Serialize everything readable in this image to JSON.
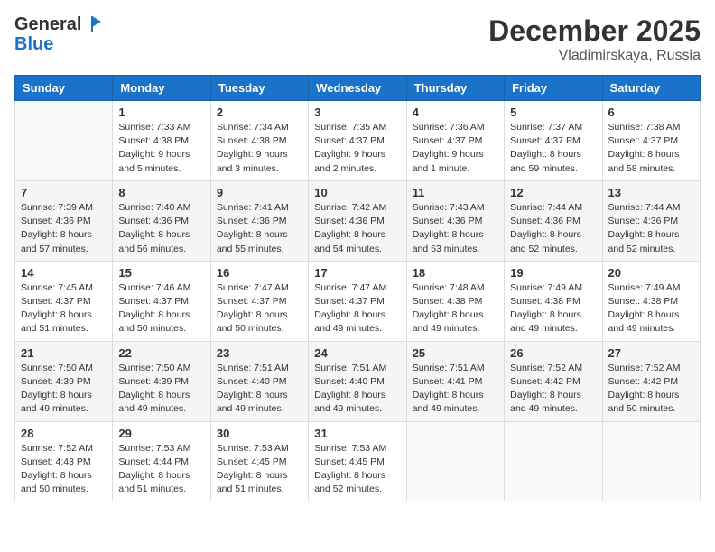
{
  "header": {
    "logo_line1": "General",
    "logo_line2": "Blue",
    "month": "December 2025",
    "location": "Vladimirskaya, Russia"
  },
  "weekdays": [
    "Sunday",
    "Monday",
    "Tuesday",
    "Wednesday",
    "Thursday",
    "Friday",
    "Saturday"
  ],
  "weeks": [
    [
      {
        "day": "",
        "sunrise": "",
        "sunset": "",
        "daylight": ""
      },
      {
        "day": "1",
        "sunrise": "Sunrise: 7:33 AM",
        "sunset": "Sunset: 4:38 PM",
        "daylight": "Daylight: 9 hours and 5 minutes."
      },
      {
        "day": "2",
        "sunrise": "Sunrise: 7:34 AM",
        "sunset": "Sunset: 4:38 PM",
        "daylight": "Daylight: 9 hours and 3 minutes."
      },
      {
        "day": "3",
        "sunrise": "Sunrise: 7:35 AM",
        "sunset": "Sunset: 4:37 PM",
        "daylight": "Daylight: 9 hours and 2 minutes."
      },
      {
        "day": "4",
        "sunrise": "Sunrise: 7:36 AM",
        "sunset": "Sunset: 4:37 PM",
        "daylight": "Daylight: 9 hours and 1 minute."
      },
      {
        "day": "5",
        "sunrise": "Sunrise: 7:37 AM",
        "sunset": "Sunset: 4:37 PM",
        "daylight": "Daylight: 8 hours and 59 minutes."
      },
      {
        "day": "6",
        "sunrise": "Sunrise: 7:38 AM",
        "sunset": "Sunset: 4:37 PM",
        "daylight": "Daylight: 8 hours and 58 minutes."
      }
    ],
    [
      {
        "day": "7",
        "sunrise": "Sunrise: 7:39 AM",
        "sunset": "Sunset: 4:36 PM",
        "daylight": "Daylight: 8 hours and 57 minutes."
      },
      {
        "day": "8",
        "sunrise": "Sunrise: 7:40 AM",
        "sunset": "Sunset: 4:36 PM",
        "daylight": "Daylight: 8 hours and 56 minutes."
      },
      {
        "day": "9",
        "sunrise": "Sunrise: 7:41 AM",
        "sunset": "Sunset: 4:36 PM",
        "daylight": "Daylight: 8 hours and 55 minutes."
      },
      {
        "day": "10",
        "sunrise": "Sunrise: 7:42 AM",
        "sunset": "Sunset: 4:36 PM",
        "daylight": "Daylight: 8 hours and 54 minutes."
      },
      {
        "day": "11",
        "sunrise": "Sunrise: 7:43 AM",
        "sunset": "Sunset: 4:36 PM",
        "daylight": "Daylight: 8 hours and 53 minutes."
      },
      {
        "day": "12",
        "sunrise": "Sunrise: 7:44 AM",
        "sunset": "Sunset: 4:36 PM",
        "daylight": "Daylight: 8 hours and 52 minutes."
      },
      {
        "day": "13",
        "sunrise": "Sunrise: 7:44 AM",
        "sunset": "Sunset: 4:36 PM",
        "daylight": "Daylight: 8 hours and 52 minutes."
      }
    ],
    [
      {
        "day": "14",
        "sunrise": "Sunrise: 7:45 AM",
        "sunset": "Sunset: 4:37 PM",
        "daylight": "Daylight: 8 hours and 51 minutes."
      },
      {
        "day": "15",
        "sunrise": "Sunrise: 7:46 AM",
        "sunset": "Sunset: 4:37 PM",
        "daylight": "Daylight: 8 hours and 50 minutes."
      },
      {
        "day": "16",
        "sunrise": "Sunrise: 7:47 AM",
        "sunset": "Sunset: 4:37 PM",
        "daylight": "Daylight: 8 hours and 50 minutes."
      },
      {
        "day": "17",
        "sunrise": "Sunrise: 7:47 AM",
        "sunset": "Sunset: 4:37 PM",
        "daylight": "Daylight: 8 hours and 49 minutes."
      },
      {
        "day": "18",
        "sunrise": "Sunrise: 7:48 AM",
        "sunset": "Sunset: 4:38 PM",
        "daylight": "Daylight: 8 hours and 49 minutes."
      },
      {
        "day": "19",
        "sunrise": "Sunrise: 7:49 AM",
        "sunset": "Sunset: 4:38 PM",
        "daylight": "Daylight: 8 hours and 49 minutes."
      },
      {
        "day": "20",
        "sunrise": "Sunrise: 7:49 AM",
        "sunset": "Sunset: 4:38 PM",
        "daylight": "Daylight: 8 hours and 49 minutes."
      }
    ],
    [
      {
        "day": "21",
        "sunrise": "Sunrise: 7:50 AM",
        "sunset": "Sunset: 4:39 PM",
        "daylight": "Daylight: 8 hours and 49 minutes."
      },
      {
        "day": "22",
        "sunrise": "Sunrise: 7:50 AM",
        "sunset": "Sunset: 4:39 PM",
        "daylight": "Daylight: 8 hours and 49 minutes."
      },
      {
        "day": "23",
        "sunrise": "Sunrise: 7:51 AM",
        "sunset": "Sunset: 4:40 PM",
        "daylight": "Daylight: 8 hours and 49 minutes."
      },
      {
        "day": "24",
        "sunrise": "Sunrise: 7:51 AM",
        "sunset": "Sunset: 4:40 PM",
        "daylight": "Daylight: 8 hours and 49 minutes."
      },
      {
        "day": "25",
        "sunrise": "Sunrise: 7:51 AM",
        "sunset": "Sunset: 4:41 PM",
        "daylight": "Daylight: 8 hours and 49 minutes."
      },
      {
        "day": "26",
        "sunrise": "Sunrise: 7:52 AM",
        "sunset": "Sunset: 4:42 PM",
        "daylight": "Daylight: 8 hours and 49 minutes."
      },
      {
        "day": "27",
        "sunrise": "Sunrise: 7:52 AM",
        "sunset": "Sunset: 4:42 PM",
        "daylight": "Daylight: 8 hours and 50 minutes."
      }
    ],
    [
      {
        "day": "28",
        "sunrise": "Sunrise: 7:52 AM",
        "sunset": "Sunset: 4:43 PM",
        "daylight": "Daylight: 8 hours and 50 minutes."
      },
      {
        "day": "29",
        "sunrise": "Sunrise: 7:53 AM",
        "sunset": "Sunset: 4:44 PM",
        "daylight": "Daylight: 8 hours and 51 minutes."
      },
      {
        "day": "30",
        "sunrise": "Sunrise: 7:53 AM",
        "sunset": "Sunset: 4:45 PM",
        "daylight": "Daylight: 8 hours and 51 minutes."
      },
      {
        "day": "31",
        "sunrise": "Sunrise: 7:53 AM",
        "sunset": "Sunset: 4:45 PM",
        "daylight": "Daylight: 8 hours and 52 minutes."
      },
      {
        "day": "",
        "sunrise": "",
        "sunset": "",
        "daylight": ""
      },
      {
        "day": "",
        "sunrise": "",
        "sunset": "",
        "daylight": ""
      },
      {
        "day": "",
        "sunrise": "",
        "sunset": "",
        "daylight": ""
      }
    ]
  ]
}
